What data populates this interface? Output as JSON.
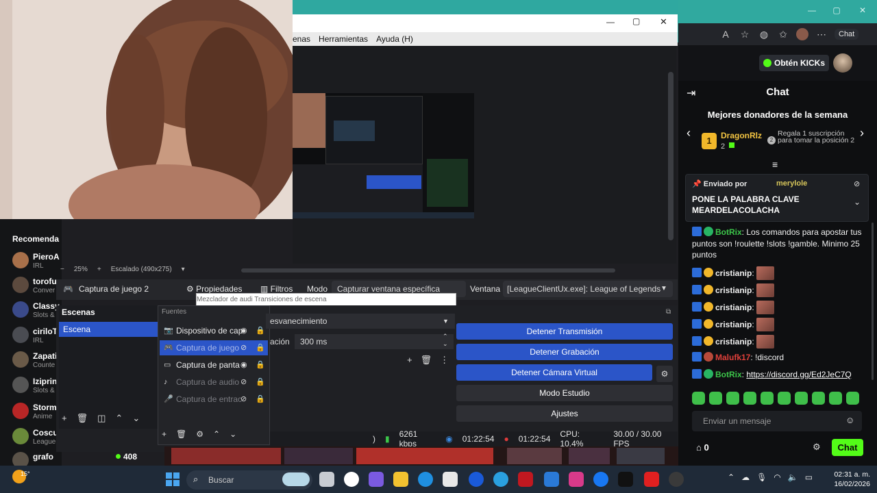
{
  "browser": {
    "chat_button_label": "Chat"
  },
  "kick": {
    "kicks_button": "Obtén KICKs",
    "chat_title": "Chat",
    "donors_title": "Mejores donadores de la semana",
    "top_donor_rank": "1",
    "top_donor_name": "DragonRlz",
    "top_donor_count": "2",
    "donor_promo": "Regala 1 suscripción para tomar la posición 2",
    "pinned_by_label": "Enviado por",
    "pinned_user": "merylole",
    "pinned_message": "PONE LA PALABRA CLAVE MEARDELACOLACHA",
    "messages": [
      {
        "user": "BotRix",
        "text": "Los comandos para apostar tus puntos son !roulette !slots !gamble. Minimo 25 puntos",
        "color": "#3cc64a"
      },
      {
        "user": "cristianip",
        "text": "",
        "color": "#ffffff"
      },
      {
        "user": "cristianip",
        "text": "",
        "color": "#ffffff"
      },
      {
        "user": "cristianip",
        "text": "",
        "color": "#ffffff"
      },
      {
        "user": "cristianip",
        "text": "",
        "color": "#ffffff"
      },
      {
        "user": "cristianip",
        "text": "",
        "color": "#ffffff"
      },
      {
        "user": "Malufk17",
        "text": "!discord",
        "color": "#e0403a"
      },
      {
        "user": "BotRix",
        "text": "https://discord.gg/Ed2JeC7Q",
        "color": "#3cc64a"
      }
    ],
    "input_placeholder": "Enviar un mensaje",
    "points": "0",
    "send_label": "Chat",
    "recommended_title": "Recomenda",
    "recommended": [
      {
        "name": "PieroA",
        "category": "IRL"
      },
      {
        "name": "torofu",
        "category": "Conver"
      },
      {
        "name": "Classy",
        "category": "Slots &"
      },
      {
        "name": "ciriloT",
        "category": "IRL"
      },
      {
        "name": "Zapati",
        "category": "Counte"
      },
      {
        "name": "Iziprin",
        "category": "Slots &"
      },
      {
        "name": "Storm",
        "category": "Anime"
      },
      {
        "name": "Coscu",
        "category": "League"
      },
      {
        "name": "grafo",
        "category": ""
      }
    ],
    "recommended_last_viewers": "408"
  },
  "obs": {
    "menu": [
      "enas",
      "Herramientas",
      "Ayuda (H)"
    ],
    "zoom": "25%",
    "scaling": "Escalado (490x275)",
    "source_name": "Captura de juego 2",
    "properties_label": "Propiedades",
    "filters_label": "Filtros",
    "mode_label": "Modo",
    "mode_value": "Capturar ventana específica",
    "window_label": "Ventana",
    "window_value": "[LeagueClientUx.exe]: League of Legends",
    "dock_tabs": "Mezclador de audi  Transiciones de escena",
    "scenes_title": "Escenas",
    "scene_item": "Escena",
    "sources_title": "Fuentes",
    "sources": [
      {
        "name": "Dispositivo de cap",
        "icon": "camera-icon",
        "visible": true
      },
      {
        "name": "Captura de juego",
        "icon": "gamepad-icon",
        "visible": false
      },
      {
        "name": "Captura de panta",
        "icon": "monitor-icon",
        "visible": true
      },
      {
        "name": "Captura de audio",
        "icon": "speaker-icon",
        "visible": false
      },
      {
        "name": "Captura de entrac",
        "icon": "mic-icon",
        "visible": false
      }
    ],
    "transition_value": "esvanecimiento",
    "duration_label": "ación",
    "duration_value": "300 ms",
    "controls": {
      "stop_stream": "Detener Transmisión",
      "stop_record": "Detener Grabación",
      "stop_vcam": "Detener Cámara Virtual",
      "studio_mode": "Modo Estudio",
      "settings": "Ajustes"
    },
    "status": {
      "dropped": ")",
      "bitrate": "6261 kbps",
      "stream_time": "01:22:54",
      "rec_time": "01:22:54",
      "cpu": "CPU: 10.4%",
      "fps": "30.00 / 30.00 FPS"
    }
  },
  "taskbar": {
    "temperature": "15°",
    "search_placeholder": "Buscar",
    "time": "02:31 a. m.",
    "date": "16/02/2026"
  }
}
